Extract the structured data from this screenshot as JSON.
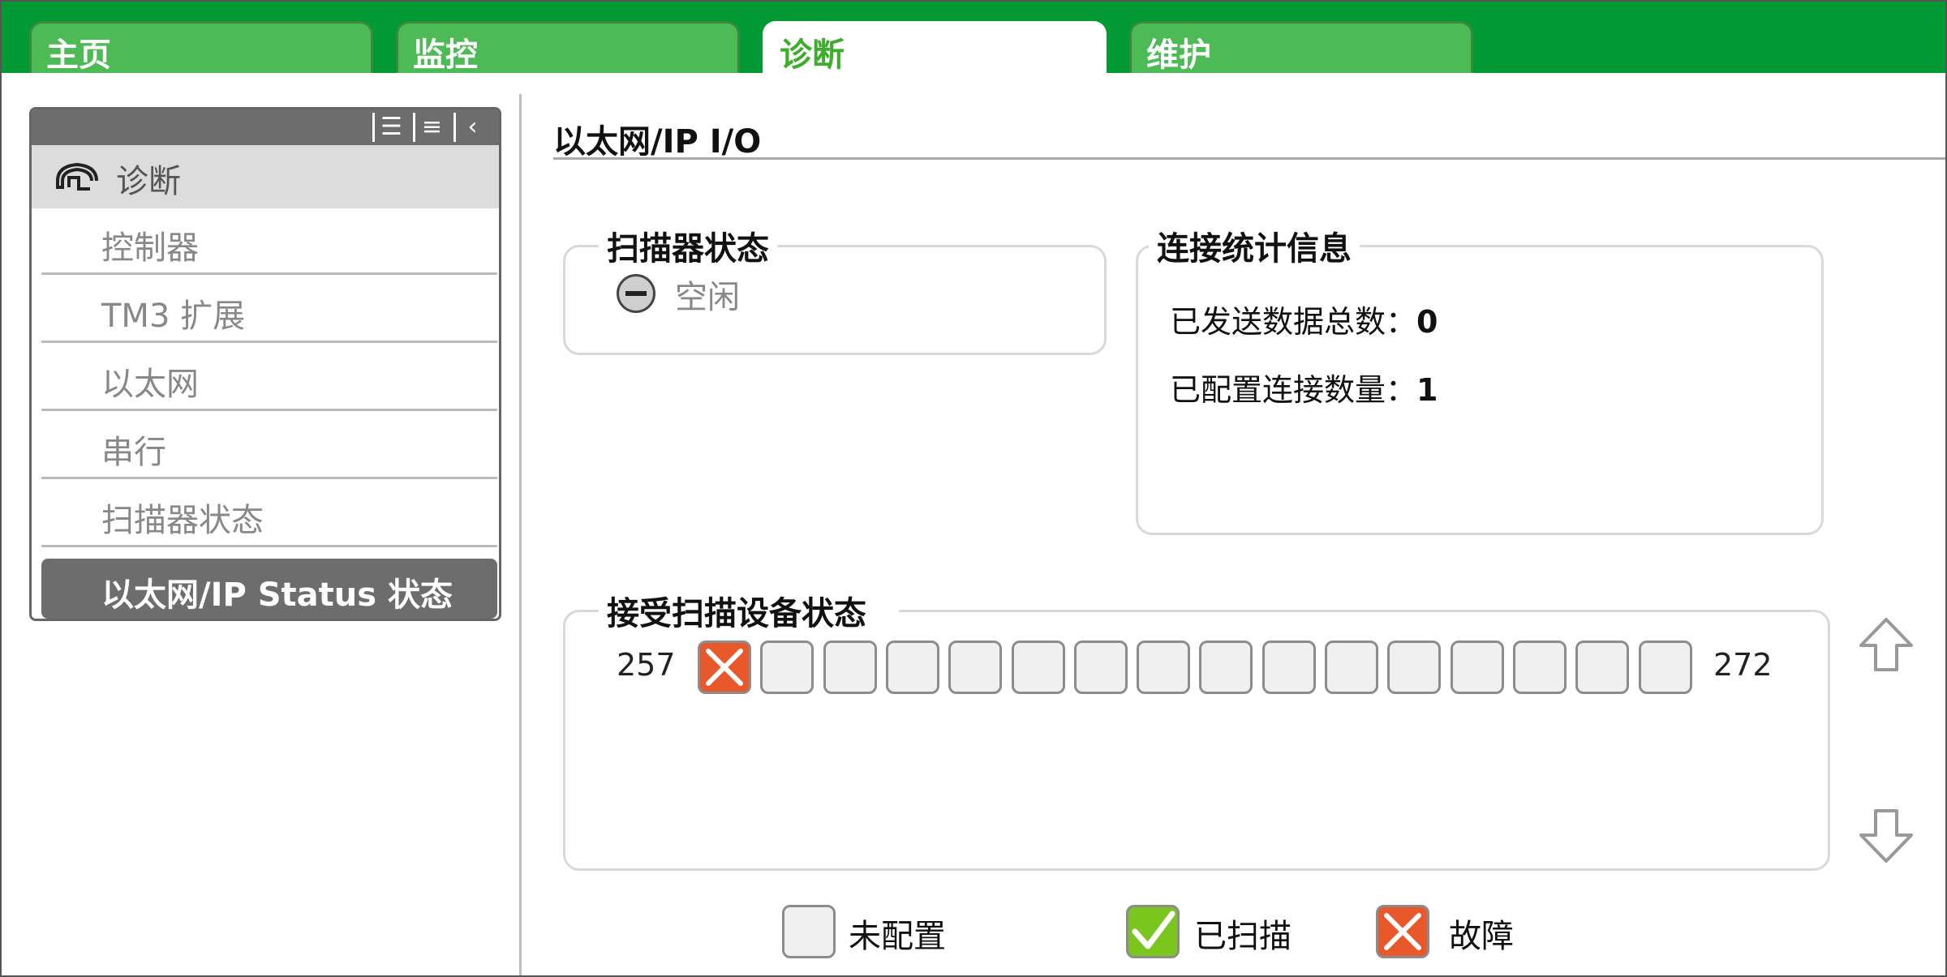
{
  "tabs": [
    {
      "label": "主页",
      "active": false
    },
    {
      "label": "监控",
      "active": false
    },
    {
      "label": "诊断",
      "active": true
    },
    {
      "label": "维护",
      "active": false
    }
  ],
  "nav": {
    "toolbar_icons": [
      "list-view-icon",
      "compact-list-icon",
      "collapse-icon"
    ],
    "header": {
      "label": "诊断",
      "icon": "diagnostics-icon"
    },
    "items": [
      {
        "label": "控制器"
      },
      {
        "label": "TM3 扩展"
      },
      {
        "label": "以太网"
      },
      {
        "label": "串行"
      },
      {
        "label": "扫描器状态"
      },
      {
        "label": "以太网/IP Status 状态",
        "selected": true
      }
    ]
  },
  "main": {
    "title": "以太网/IP I/O",
    "scanner_status": {
      "label": "扫描器状态",
      "state": "空闲",
      "icon": "idle-icon"
    },
    "connection_stats": {
      "label": "连接统计信息",
      "rows": [
        {
          "label": "已发送数据总数：",
          "value": "0"
        },
        {
          "label": "已配置连接数量：",
          "value": "1"
        }
      ]
    },
    "scanned_devices": {
      "label": "接受扫描设备状态",
      "range_start": "257",
      "range_end": "272",
      "cells": [
        "fault",
        "unconfigured",
        "unconfigured",
        "unconfigured",
        "unconfigured",
        "unconfigured",
        "unconfigured",
        "unconfigured",
        "unconfigured",
        "unconfigured",
        "unconfigured",
        "unconfigured",
        "unconfigured",
        "unconfigured",
        "unconfigured",
        "unconfigured"
      ]
    },
    "legend": [
      {
        "state": "unconfigured",
        "label": "未配置"
      },
      {
        "state": "scanned",
        "label": "已扫描"
      },
      {
        "state": "fault",
        "label": "故障"
      }
    ]
  },
  "colors": {
    "tabbar": "#009933",
    "tab": "#4cbb55",
    "active_tab_text": "#3dae2b",
    "fault": "#e8582a",
    "scanned": "#7ac61f",
    "unconfigured": "#f0f0f0"
  }
}
